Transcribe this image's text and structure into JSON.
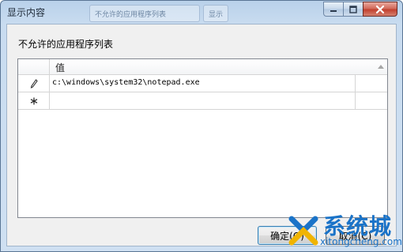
{
  "window": {
    "title": "显示内容",
    "background_tabs": [
      "不允许的应用程序列表",
      "显示"
    ]
  },
  "caption_buttons": {
    "minimize_glyph": "—",
    "maximize_glyph": "□",
    "close_glyph": "✕"
  },
  "content": {
    "list_label": "不允许的应用程序列表",
    "column_header": "值",
    "rows": [
      {
        "marker_icon": "pencil-icon",
        "marker_glyph": "✎",
        "value": "c:\\windows\\system32\\notepad.exe"
      },
      {
        "marker_icon": "asterisk-icon",
        "marker_glyph": "✱",
        "value": ""
      }
    ]
  },
  "buttons": {
    "ok_label": "确定(O)",
    "cancel_label": "取消(C)"
  },
  "watermark": {
    "brand": "系统城",
    "domain": "xitongcheng.com"
  },
  "colors": {
    "title_bar": "#b9d1ea",
    "close_button": "#c2412f",
    "watermark": "#1a73c8"
  }
}
